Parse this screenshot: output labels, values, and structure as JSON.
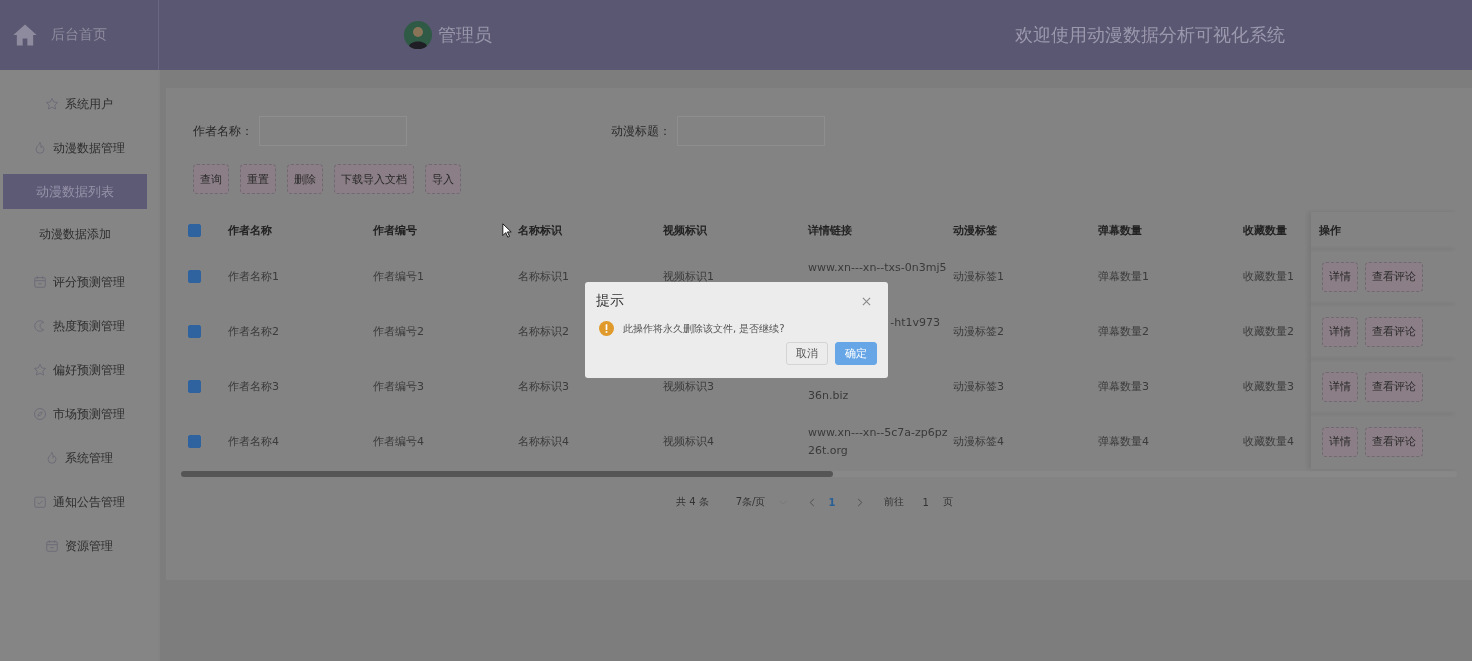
{
  "header": {
    "home_label": "后台首页",
    "user": "管理员",
    "title": "欢迎使用动漫数据分析可视化系统"
  },
  "sidebar": {
    "items": [
      {
        "label": "系统用户",
        "selected": false
      },
      {
        "label": "动漫数据管理",
        "selected": false,
        "children": [
          {
            "label": "动漫数据列表",
            "selected": true
          },
          {
            "label": "动漫数据添加",
            "selected": false
          }
        ]
      },
      {
        "label": "评分预测管理",
        "selected": false
      },
      {
        "label": "热度预测管理",
        "selected": false
      },
      {
        "label": "偏好预测管理",
        "selected": false
      },
      {
        "label": "市场预测管理",
        "selected": false
      },
      {
        "label": "系统管理",
        "selected": false
      },
      {
        "label": "通知公告管理",
        "selected": false
      },
      {
        "label": "资源管理",
        "selected": false
      }
    ]
  },
  "search": {
    "fields": [
      {
        "label": "作者名称："
      },
      {
        "label": "动漫标题："
      }
    ]
  },
  "toolbar": {
    "buttons": [
      "查询",
      "重置",
      "删除",
      "下载导入文档",
      "导入"
    ]
  },
  "table": {
    "all_checked": true,
    "columns": [
      "作者名称",
      "作者编号",
      "名称标识",
      "视频标识",
      "详情链接",
      "动漫标签",
      "弹幕数量",
      "收藏数量",
      "操作"
    ],
    "rows": [
      {
        "checked": true,
        "cells": [
          "作者名称1",
          "作者编号1",
          "名称标识1",
          "视频标识1",
          {
            "top": "www.xn---xn--txs-0n3mj5"
          },
          "动漫标签1",
          "弹幕数量1",
          "收藏数量1"
        ],
        "actions": [
          "详情",
          "查看评论"
        ]
      },
      {
        "checked": true,
        "cells": [
          "作者名称2",
          "作者编号2",
          "名称标识2",
          null,
          {
            "top": "-ht1v973",
            "covered_left": true
          },
          "动漫标签2",
          "弹幕数量2",
          "收藏数量2"
        ],
        "actions": [
          "详情",
          "查看评论"
        ]
      },
      {
        "checked": true,
        "cells": [
          "作者名称3",
          "作者编号3",
          "名称标识3",
          "视频标识3",
          {
            "bottom": "36n.biz"
          },
          "动漫标签3",
          "弹幕数量3",
          "收藏数量3"
        ],
        "actions": [
          "详情",
          "查看评论"
        ]
      },
      {
        "checked": true,
        "cells": [
          "作者名称4",
          "作者编号4",
          "名称标识4",
          "视频标识4",
          {
            "top": "www.xn---xn--5c7a-zp6pz",
            "bottom": "26t.org"
          },
          "动漫标签4",
          "弹幕数量4",
          "收藏数量4"
        ],
        "actions": [
          "详情",
          "查看评论"
        ]
      }
    ]
  },
  "pagination": {
    "total": "共 4 条",
    "page_size": "7条/页",
    "pages": [
      {
        "label": "1",
        "selected": true
      }
    ],
    "goto_label": "前往",
    "goto_value": "1",
    "page_unit": "页"
  },
  "dialog": {
    "title": "提示",
    "message": "此操作将永久删除该文件, 是否继续?",
    "buttons": [
      {
        "label": "取消",
        "kind": "default"
      },
      {
        "label": "确定",
        "kind": "primary"
      }
    ]
  }
}
